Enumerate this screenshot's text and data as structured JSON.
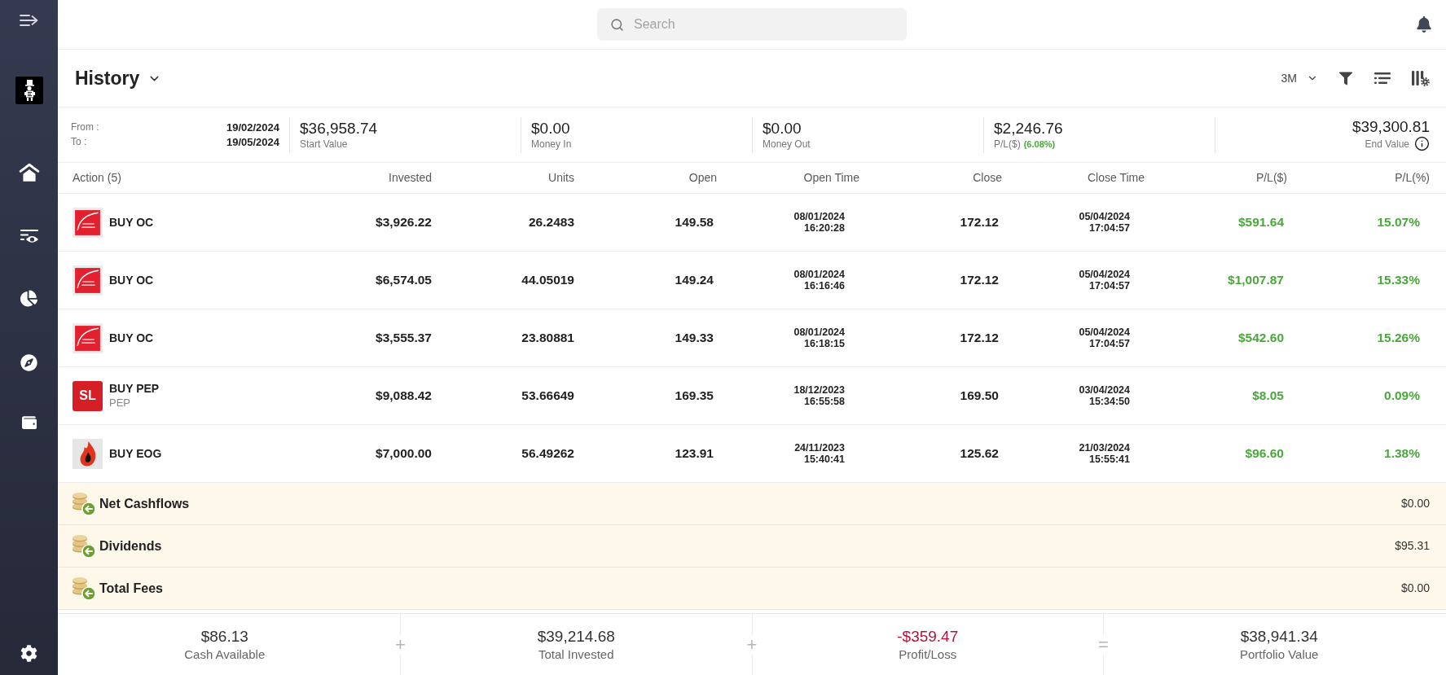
{
  "search": {
    "placeholder": "Search"
  },
  "header": {
    "title": "History",
    "period": "3M"
  },
  "range": {
    "from_label": "From :",
    "from": "19/02/2024",
    "to_label": "To :",
    "to": "19/05/2024"
  },
  "summary": [
    {
      "kind": "stat",
      "value": "$36,958.74",
      "label": "Start Value"
    },
    {
      "kind": "stat",
      "value": "$0.00",
      "label": "Money In"
    },
    {
      "kind": "stat",
      "value": "$0.00",
      "label": "Money Out"
    },
    {
      "kind": "stat",
      "value": "$2,246.76",
      "label": "P/L($)",
      "change": "(6.08%)"
    },
    {
      "kind": "total",
      "value": "$39,300.81",
      "label": "End Value"
    }
  ],
  "table": {
    "columns": [
      "Action (5)",
      "Invested",
      "Units",
      "Open",
      "Open Time",
      "Close",
      "Close Time",
      "P/L($)",
      "P/L(%)"
    ],
    "rows": [
      {
        "logo": {
          "kind": "arc"
        },
        "action": "BUY OC",
        "invested": "$3,926.22",
        "units": "26.2483",
        "open": "149.58",
        "open_time": [
          "08/01/2024",
          "16:20:28"
        ],
        "close": "172.12",
        "close_time": [
          "05/04/2024",
          "17:04:57"
        ],
        "pl": "$591.64",
        "pl_pct": "15.07%"
      },
      {
        "logo": {
          "kind": "arc"
        },
        "action": "BUY OC",
        "invested": "$6,574.05",
        "units": "44.05019",
        "open": "149.24",
        "open_time": [
          "08/01/2024",
          "16:16:46"
        ],
        "close": "172.12",
        "close_time": [
          "05/04/2024",
          "17:04:57"
        ],
        "pl": "$1,007.87",
        "pl_pct": "15.33%"
      },
      {
        "logo": {
          "kind": "arc"
        },
        "action": "BUY OC",
        "invested": "$3,555.37",
        "units": "23.80881",
        "open": "149.33",
        "open_time": [
          "08/01/2024",
          "16:18:15"
        ],
        "close": "172.12",
        "close_time": [
          "05/04/2024",
          "17:04:57"
        ],
        "pl": "$542.60",
        "pl_pct": "15.26%"
      },
      {
        "logo": {
          "kind": "initials",
          "text": "SL"
        },
        "action": "BUY PEP",
        "symbol": "PEP",
        "invested": "$9,088.42",
        "units": "53.66649",
        "open": "169.35",
        "open_time": [
          "18/12/2023",
          "16:55:58"
        ],
        "close": "169.50",
        "close_time": [
          "03/04/2024",
          "15:34:50"
        ],
        "pl": "$8.05",
        "pl_pct": "0.09%"
      },
      {
        "logo": {
          "kind": "flame"
        },
        "action": "BUY EOG",
        "invested": "$7,000.00",
        "units": "56.49262",
        "open": "123.91",
        "open_time": [
          "24/11/2023",
          "15:40:41"
        ],
        "close": "125.62",
        "close_time": [
          "21/03/2024",
          "15:55:41"
        ],
        "pl": "$96.60",
        "pl_pct": "1.38%"
      }
    ]
  },
  "cashflows": [
    {
      "label": "Net Cashflows",
      "value": "$0.00"
    },
    {
      "label": "Dividends",
      "value": "$95.31"
    },
    {
      "label": "Total Fees",
      "value": "$0.00"
    }
  ],
  "footer": {
    "items": [
      {
        "value": "$86.13",
        "label": "Cash Available",
        "negative": false
      },
      {
        "value": "$39,214.68",
        "label": "Total Invested",
        "negative": false
      },
      {
        "value": "-$359.47",
        "label": "Profit/Loss",
        "negative": true
      },
      {
        "value": "$38,941.34",
        "label": "Portfolio Value",
        "negative": false
      }
    ],
    "operators": [
      "+",
      "+",
      "="
    ]
  }
}
